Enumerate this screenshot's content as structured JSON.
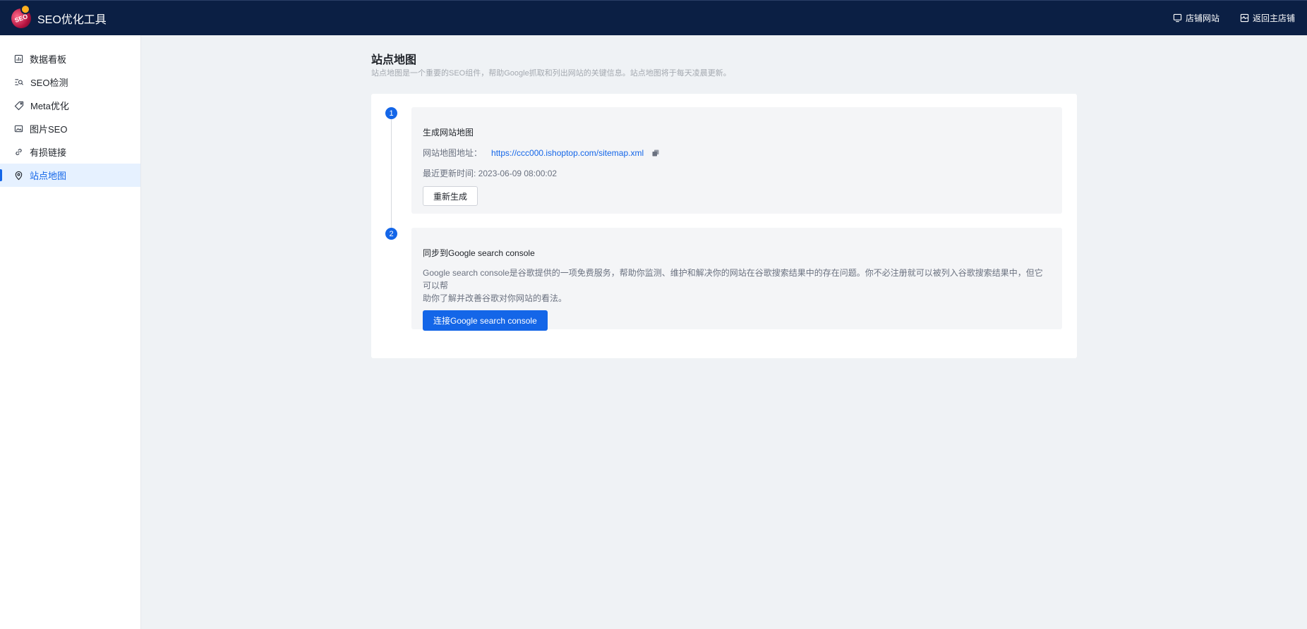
{
  "header": {
    "logo_text": "SEO",
    "title": "SEO优化工具",
    "actions": [
      {
        "label": "店铺网站",
        "icon": "monitor-icon"
      },
      {
        "label": "返回主店铺",
        "icon": "store-icon"
      }
    ]
  },
  "sidebar": {
    "items": [
      {
        "label": "数据看板",
        "icon": "dashboard-icon",
        "active": false
      },
      {
        "label": "SEO检测",
        "icon": "seo-check-icon",
        "active": false
      },
      {
        "label": "Meta优化",
        "icon": "tag-icon",
        "active": false
      },
      {
        "label": "图片SEO",
        "icon": "image-icon",
        "active": false
      },
      {
        "label": "有损链接",
        "icon": "link-icon",
        "active": false
      },
      {
        "label": "站点地图",
        "icon": "location-pin-icon",
        "active": true
      }
    ]
  },
  "main": {
    "title": "站点地图",
    "description": "站点地图是一个重要的SEO组件，帮助Google抓取和列出网站的关键信息。站点地图将于每天凌晨更新。",
    "steps": [
      {
        "number": "1",
        "title": "生成网站地图",
        "url_label": "网站地图地址：",
        "url": "https://ccc000.ishoptop.com/sitemap.xml",
        "updated": "最近更新时间: 2023-06-09 08:00:02",
        "button": "重新生成"
      },
      {
        "number": "2",
        "title": "同步到Google search console",
        "description_line1": "Google search console是谷歌提供的一项免费服务，帮助你监测、维护和解决你的网站在谷歌搜索结果中的存在问题。你不必注册就可以被列入谷歌搜索结果中，但它可以帮",
        "description_line2": "助你了解并改善谷歌对你网站的看法。",
        "button": "连接Google search console"
      }
    ]
  },
  "colors": {
    "header_bg": "#0b1f44",
    "accent": "#1466e8",
    "page_bg": "#eff2f5",
    "step_bg": "#f4f5f7"
  }
}
